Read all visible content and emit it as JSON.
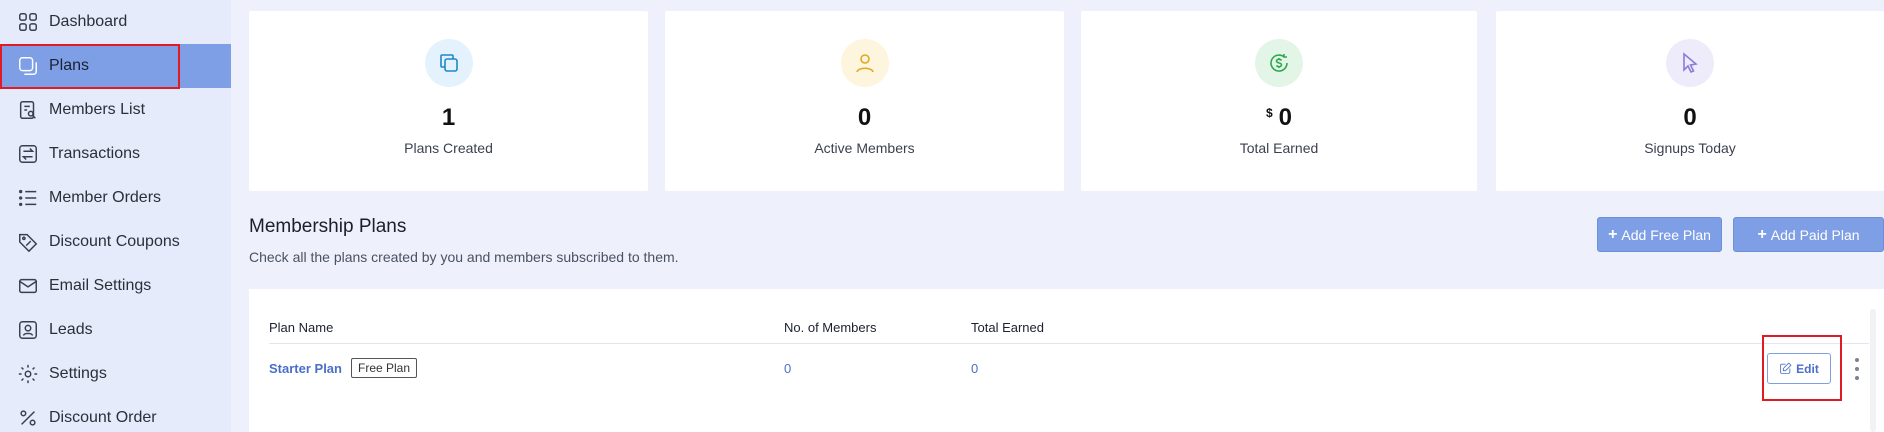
{
  "sidebar": {
    "items": [
      {
        "label": "Dashboard",
        "icon": "dashboard-icon"
      },
      {
        "label": "Plans",
        "icon": "plans-icon",
        "active": true
      },
      {
        "label": "Members List",
        "icon": "members-list-icon"
      },
      {
        "label": "Transactions",
        "icon": "transactions-icon"
      },
      {
        "label": "Member Orders",
        "icon": "list-icon"
      },
      {
        "label": "Discount Coupons",
        "icon": "coupon-icon"
      },
      {
        "label": "Email Settings",
        "icon": "mail-icon"
      },
      {
        "label": "Leads",
        "icon": "leads-icon"
      },
      {
        "label": "Settings",
        "icon": "gear-icon"
      },
      {
        "label": "Discount Order",
        "icon": "percent-icon"
      }
    ]
  },
  "stats": [
    {
      "value": "1",
      "label": "Plans Created",
      "icon": "copy-icon",
      "color": "#1e88c8",
      "bg": "#e3f2fd"
    },
    {
      "value": "0",
      "label": "Active Members",
      "icon": "user-icon",
      "color": "#e0a91e",
      "bg": "#fdf5dd"
    },
    {
      "currency": "$",
      "value": "0",
      "label": "Total Earned",
      "icon": "dollar-refresh-icon",
      "color": "#2fa84f",
      "bg": "#e3f5e6"
    },
    {
      "value": "0",
      "label": "Signups Today",
      "icon": "cursor-icon",
      "color": "#8d7bd6",
      "bg": "#eeebfa"
    }
  ],
  "section": {
    "title": "Membership Plans",
    "subtitle": "Check all the plans created by you and members subscribed to them.",
    "add_free_label": "Add Free Plan",
    "add_paid_label": "Add Paid Plan"
  },
  "table": {
    "headers": [
      "Plan Name",
      "No. of Members",
      "Total Earned"
    ],
    "rows": [
      {
        "plan_name": "Starter Plan",
        "badge": "Free Plan",
        "members": "0",
        "earned": "0",
        "edit_label": "Edit"
      }
    ]
  }
}
